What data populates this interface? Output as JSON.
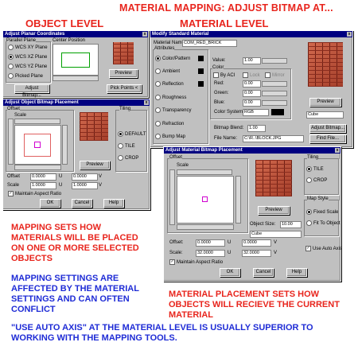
{
  "headings": {
    "top_title": "MATERIAL MAPPING: ADJUST BITMAP AT...",
    "object_level": "OBJECT LEVEL",
    "material_level": "MATERIAL LEVEL"
  },
  "callouts": {
    "mapping_sets": "MAPPING SETS HOW MATERIALS WILL BE PLACED ON ONE OR MORE SELECTED OBJECTS",
    "mapping_settings": "MAPPING SETTINGS ARE AFFECTED BY THE MATERIAL SETTINGS AND CAN OFTEN CONFLICT",
    "placement_sets": "MATERIAL PLACEMENT SETS HOW OBJECTS WILL RECIEVE THE CURRENT MATERIAL",
    "use_auto_axis": "\"USE AUTO AXIS\" AT THE MATERIAL LEVEL IS USUALLY SUPERIOR TO WORKING WITH THE MAPPING TOOLS."
  },
  "planar_dialog": {
    "title": "Adjust Planar Coordinates",
    "parallel_plane": "Parallel Plane",
    "center_position": "Center Position",
    "planes": [
      "WCS XY Plane",
      "WCS XZ Plane",
      "WCS YZ Plane",
      "Picked Plane"
    ],
    "preview": "Preview",
    "adjust_bitmap": "Adjust Bitmap...",
    "pick_points": "Pick Points <",
    "ok": "OK",
    "cancel": "Cancel",
    "help": "Help"
  },
  "obj_bitmap_dialog": {
    "title": "Adjust Object Bitmap Placement",
    "offset_group": "Offset",
    "scale": "Scale",
    "tiling": "Tiling",
    "tiling_options": [
      "DEFAULT",
      "TILE",
      "CROP"
    ],
    "preview": "Preview",
    "offset_label": "Offset",
    "offset_u": "0.0000",
    "offset_v": "0.0000",
    "scale_label": "Scale",
    "scale_u": "1.0000",
    "scale_v": "1.0000",
    "u": "U",
    "v": "V",
    "maintain_aspect": "Maintain Aspect Ratio",
    "ok": "OK",
    "cancel": "Cancel",
    "help": "Help"
  },
  "material_dialog": {
    "title": "Modify Standard Material",
    "material_name_label": "Material Name:",
    "material_name": "COM_RED_BRICK",
    "attributes": "Attributes",
    "attr_list": [
      "Color/Pattern",
      "Ambient",
      "Reflection",
      "Roughness",
      "Transparency",
      "Refraction",
      "Bump Map"
    ],
    "value_label": "Value:",
    "value": "1.00",
    "color": "Color",
    "by_aci": "By ACI",
    "lock": "Lock",
    "mirror": "Mirror",
    "red": "Red:",
    "green": "Green:",
    "blue": "Blue:",
    "rgb_val": "0.00",
    "color_system": "Color System:",
    "color_system_val": "RGB",
    "preview": "Preview",
    "preview_shape": "Cube",
    "bitmap_blend": "Bitmap Blend:",
    "bitmap_blend_val": "1.00",
    "file_name": "File Name:",
    "file_name_val": "C:\\R..\\BLOCK.JPG",
    "adjust_bitmap": "Adjust Bitmap...",
    "find_file": "Find File..."
  },
  "mat_bitmap_dialog": {
    "title": "Adjust Material Bitmap Placement",
    "offset_group": "Offset",
    "scale": "Scale",
    "tiling": "Tiling",
    "tiling_options": [
      "TILE",
      "CROP"
    ],
    "preview": "Preview",
    "map_style": "Map Style",
    "map_options": [
      "Fixed Scale",
      "Fit To Object"
    ],
    "object_size": "Object Size:",
    "object_size_val": "10.00",
    "shape": "Cube",
    "offset_label": "Offset:",
    "offset_u": "0.0000",
    "offset_v": "0.0000",
    "scale_label": "Scale:",
    "scale_u": "32.0000",
    "scale_v": "32.0000",
    "u": "U",
    "v": "V",
    "maintain_aspect": "Maintain Aspect Ratio",
    "use_auto_axis": "Use Auto Axis",
    "ok": "OK",
    "cancel": "Cancel",
    "help": "Help"
  }
}
